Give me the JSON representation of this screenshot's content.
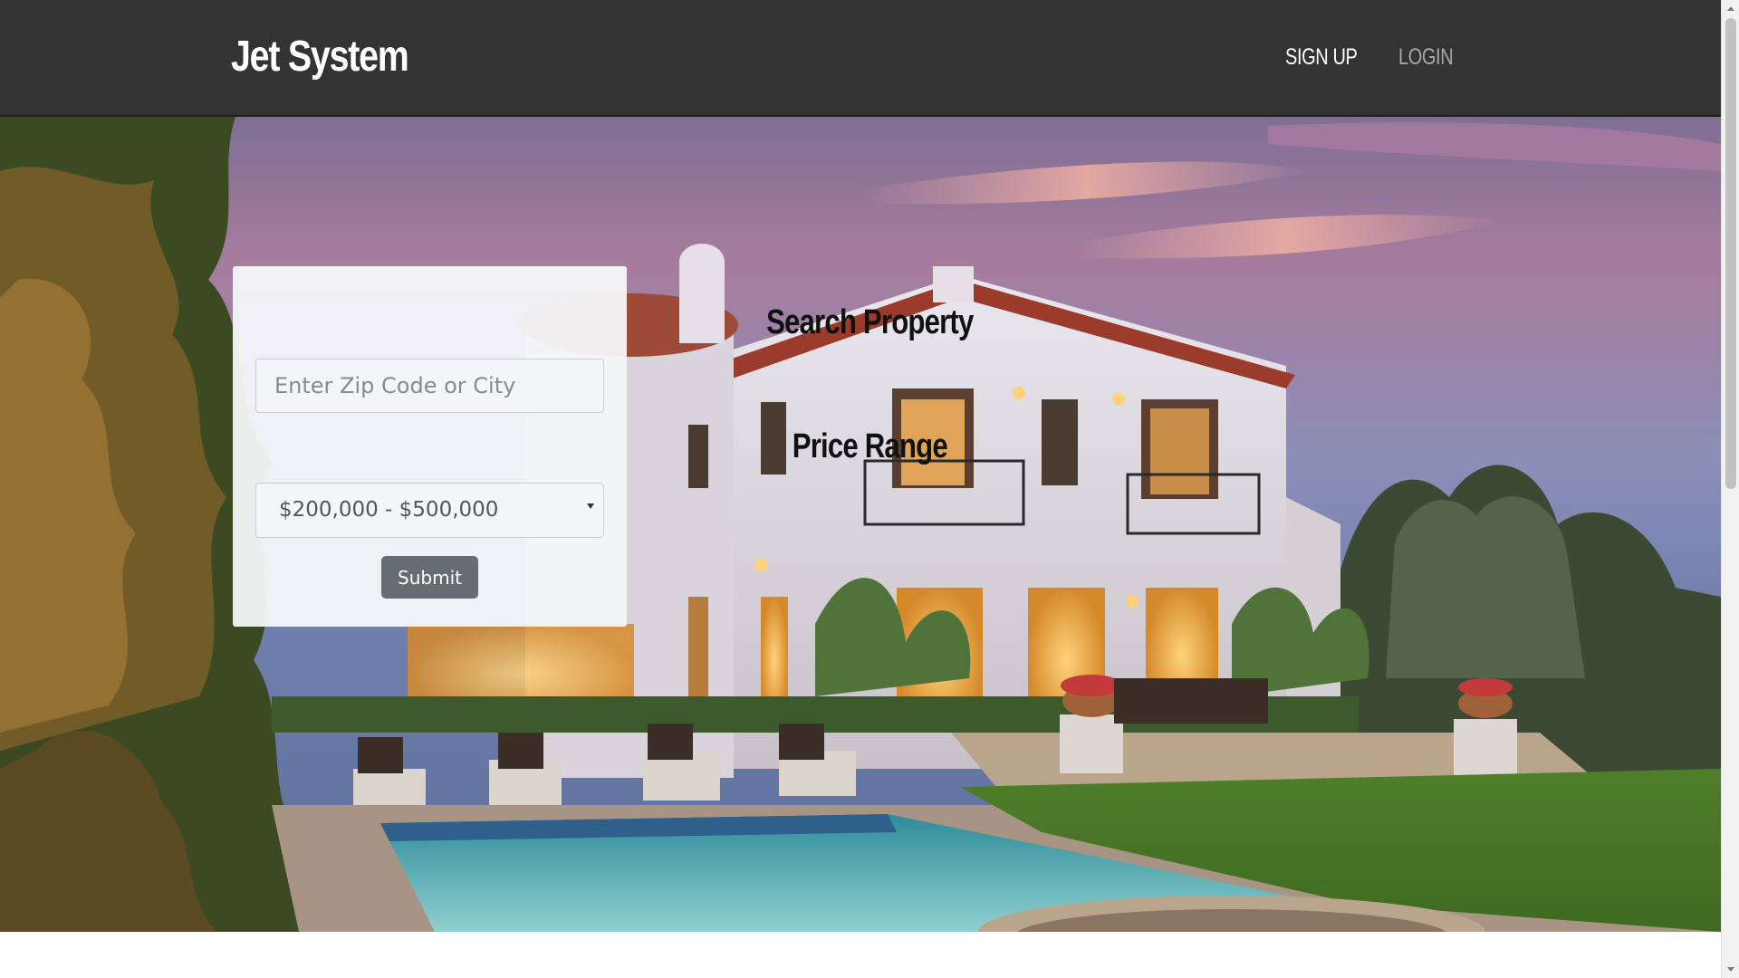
{
  "navbar": {
    "brand": "Jet System",
    "links": [
      {
        "label": "SIGN UP"
      },
      {
        "label": "LOGIN"
      }
    ]
  },
  "search_card": {
    "title": "Search Property",
    "location_input": {
      "value": "",
      "placeholder": "Enter Zip Code or City"
    },
    "price_label": "Price Range",
    "price_select": {
      "selected": "$200,000 - $500,000"
    },
    "submit_label": "Submit"
  },
  "hero": {
    "image": "luxury-villa-with-pool-at-dusk"
  },
  "colors": {
    "navbar_bg": "#333333",
    "brand_text": "#ffffff",
    "login_text": "#a8a8a8",
    "card_bg": "#f4f5f7",
    "submit_bg": "#666c73"
  }
}
